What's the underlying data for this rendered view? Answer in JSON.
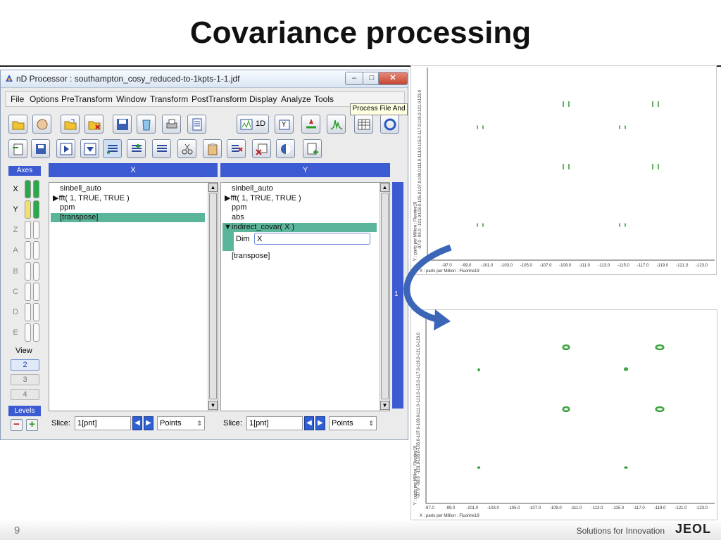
{
  "slide": {
    "title": "Covariance processing",
    "page_number": "9",
    "footer_text": "Solutions for Innovation",
    "logo": "JEOL"
  },
  "window": {
    "title": "nD Processor : southampton_cosy_reduced-to-1kpts-1-1.jdf",
    "controls": {
      "minimize": "–",
      "maximize": "□",
      "close": "✕"
    },
    "menu": [
      "File",
      "Options",
      "PreTransform",
      "Window",
      "Transform",
      "PostTransform",
      "Display",
      "Analyze",
      "Tools"
    ],
    "tooltip": "Process File And",
    "toolbar": {
      "btn_1d": "1D"
    }
  },
  "axes_panel": {
    "header": "Axes",
    "axes": [
      "X",
      "Y",
      "Z",
      "A",
      "B",
      "C",
      "D",
      "E"
    ],
    "view_label": "View",
    "views": [
      "2",
      "3",
      "4"
    ],
    "selected_view": "2",
    "levels_label": "Levels",
    "level_minus": "−",
    "level_plus": "+"
  },
  "columns": {
    "x": {
      "header": "X",
      "items": [
        "sinbell_auto",
        "▶fft( 1, TRUE, TRUE )",
        "ppm",
        "[transpose]"
      ],
      "slice_label": "Slice:",
      "slice_value": "1[pnt]",
      "units": "Points"
    },
    "y": {
      "header": "Y",
      "items": [
        "sinbell_auto",
        "▶fft( 1, TRUE, TRUE )",
        "ppm",
        "abs",
        "▼indirect_covar( X )",
        "[transpose]"
      ],
      "param_label": "Dim",
      "param_value": "X",
      "slice_label": "Slice:",
      "slice_value": "1[pnt]",
      "units": "Points"
    },
    "strip_number": "1"
  },
  "spectra": {
    "top": {
      "x_label": "X : parts per Million : Fluorine19",
      "y_label": "Y : parts per Million : Fluorine19",
      "x_ticks": [
        "-97.0",
        "-99.0",
        "-101.0",
        "-103.0",
        "-105.0",
        "-107.0",
        "-109.0",
        "-111.0",
        "-113.0",
        "-115.0",
        "-117.0",
        "-119.0",
        "-121.0",
        "-123.0"
      ],
      "y_ticks": [
        "-123.0",
        "-121.0",
        "-119.0",
        "-117.0",
        "-115.0",
        "-113.0",
        "-111.0",
        "-109.0",
        "-107.0",
        "-105.0",
        "-103.0",
        "-101.0",
        "-99.0",
        "-97.0"
      ]
    },
    "bottom": {
      "x_label": "X : parts per Million : Fluorine19",
      "y_label": "Y : parts per Million : Fluorine19",
      "x_ticks": [
        "-97.0",
        "-99.0",
        "-101.0",
        "-103.0",
        "-105.0",
        "-107.0",
        "-109.0",
        "-111.0",
        "-113.0",
        "-115.0",
        "-117.0",
        "-119.0",
        "-121.0",
        "-123.0"
      ],
      "y_ticks": [
        "-123.0",
        "-121.0",
        "-119.0",
        "-117.0",
        "-115.0",
        "-113.0",
        "-111.0",
        "-109.0",
        "-107.0",
        "-105.0",
        "-103.0",
        "-101.0",
        "-99.0",
        "-97.0"
      ]
    },
    "peak_color": "#2a9a2a",
    "arrow_color": "#3b66b8"
  }
}
